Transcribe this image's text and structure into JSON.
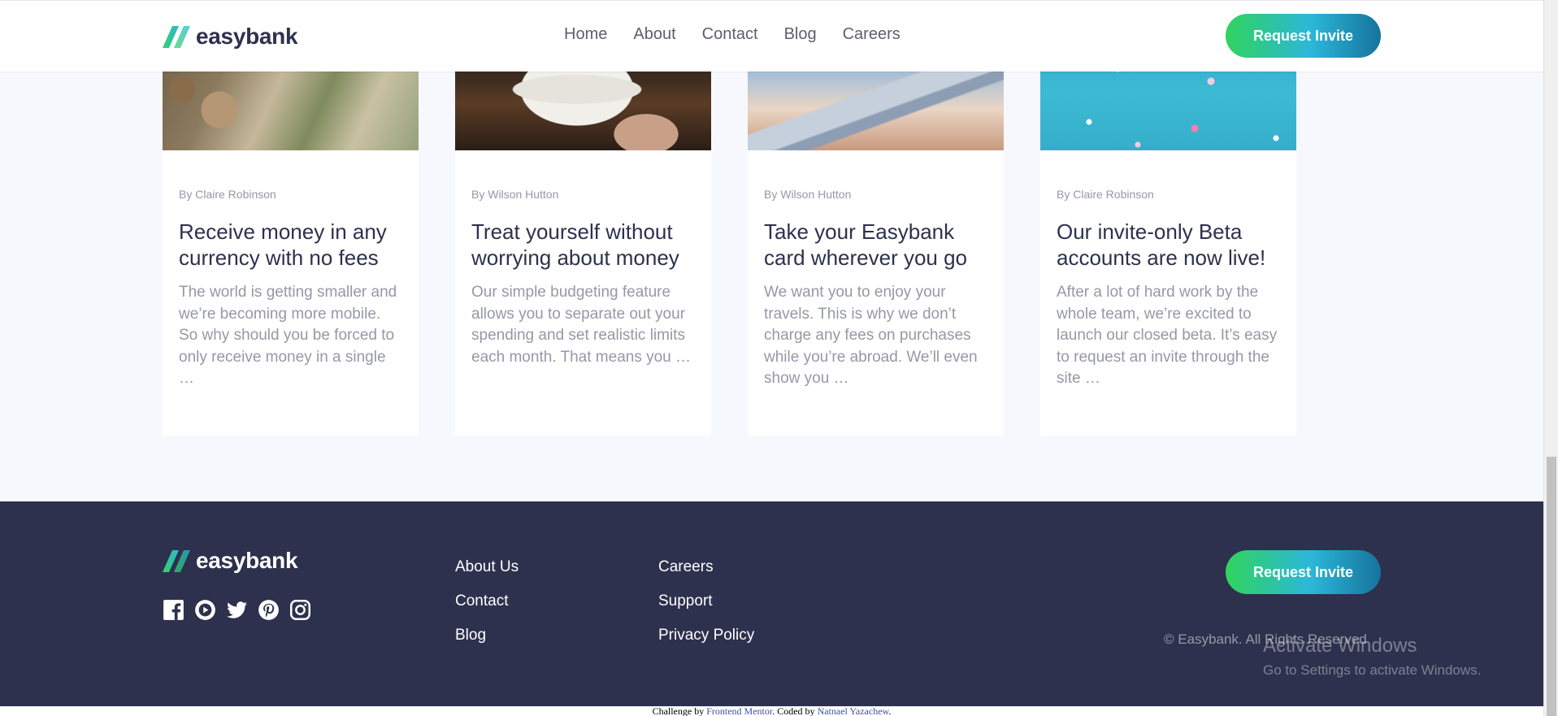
{
  "brand": {
    "name": "easybank"
  },
  "nav": {
    "items": [
      "Home",
      "About",
      "Contact",
      "Blog",
      "Careers"
    ]
  },
  "cta": {
    "label": "Request Invite"
  },
  "articles": [
    {
      "author": "By Claire Robinson",
      "title": "Receive money in any currency with no fees",
      "excerpt": "The world is getting smaller and we’re becoming more mobile. So why should you be forced to only receive money in a single …",
      "image": "currency-notes"
    },
    {
      "author": "By Wilson Hutton",
      "title": "Treat yourself without worrying about money",
      "excerpt": "Our simple budgeting feature allows you to separate out your spending and set realistic limits each month. That means you …",
      "image": "restaurant-dinner"
    },
    {
      "author": "By Wilson Hutton",
      "title": "Take your Easybank card wherever you go",
      "excerpt": "We want you to enjoy your travels. This is why we don’t charge any fees on purchases while you’re abroad. We’ll even show you …",
      "image": "airplane-wing"
    },
    {
      "author": "By Claire Robinson",
      "title": "Our invite-only Beta accounts are now live!",
      "excerpt": "After a lot of hard work by the whole team, we’re excited to launch our closed beta. It’s easy to request an invite through the site …",
      "image": "confetti"
    }
  ],
  "footer": {
    "socials": [
      "facebook-icon",
      "youtube-icon",
      "twitter-icon",
      "pinterest-icon",
      "instagram-icon"
    ],
    "links_col1": [
      "About Us",
      "Contact",
      "Blog"
    ],
    "links_col2": [
      "Careers",
      "Support",
      "Privacy Policy"
    ],
    "copyright": "© Easybank. All Rights Reserved"
  },
  "windows_overlay": {
    "title": "Activate Windows",
    "subtitle": "Go to Settings to activate Windows."
  },
  "attribution": {
    "prefix": "Challenge by ",
    "challenge_link": "Frontend Mentor",
    "middle": ". Coded by ",
    "author_link": "Natnael Yazachew",
    "suffix": "."
  },
  "colors": {
    "dark_blue": "#2d314d",
    "lime_green": "#31d35c",
    "bright_cyan": "#2bb7da",
    "grayish_blue": "#9698a6",
    "very_light_gray": "#f7f8fd"
  }
}
